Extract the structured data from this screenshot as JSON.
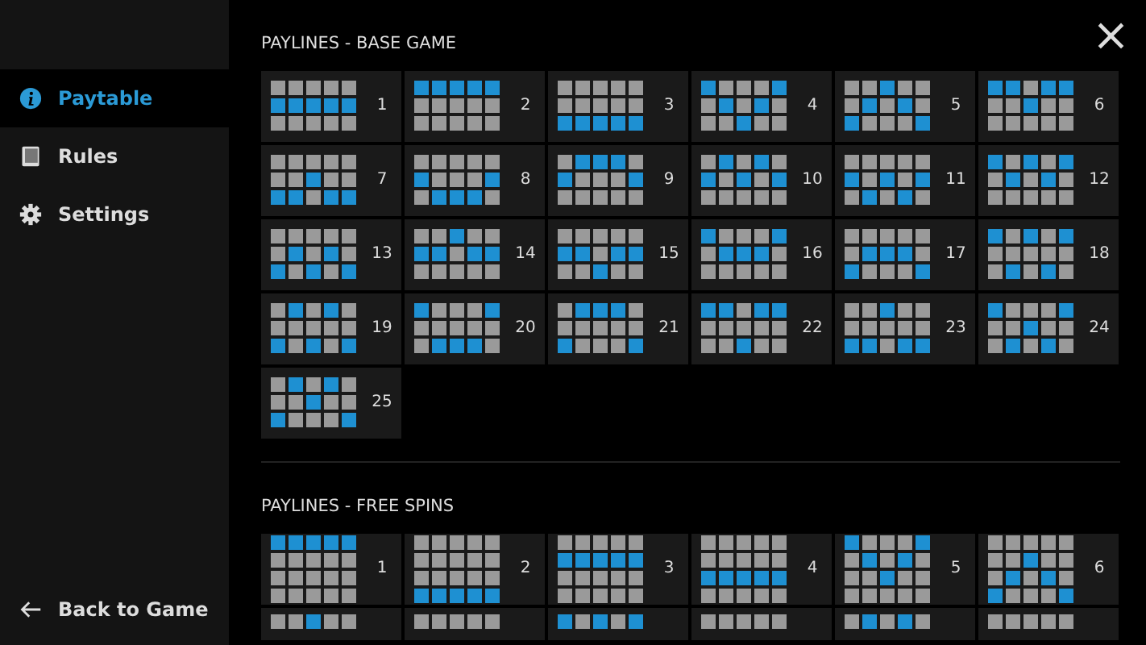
{
  "sidebar": {
    "items": [
      {
        "label": "Paytable",
        "selected": true
      },
      {
        "label": "Rules",
        "selected": false
      },
      {
        "label": "Settings",
        "selected": false
      }
    ],
    "back": {
      "label": "Back to Game"
    }
  },
  "close": {
    "label": "×"
  },
  "sections": [
    {
      "title": "PAYLINES - BASE GAME",
      "lines": [
        {
          "number": "1",
          "cells": [
            [
              false,
              false,
              false,
              false,
              false
            ],
            [
              true,
              true,
              true,
              true,
              true
            ],
            [
              false,
              false,
              false,
              false,
              false
            ]
          ]
        },
        {
          "number": "2",
          "cells": [
            [
              true,
              true,
              true,
              true,
              true
            ],
            [
              false,
              false,
              false,
              false,
              false
            ],
            [
              false,
              false,
              false,
              false,
              false
            ]
          ]
        },
        {
          "number": "3",
          "cells": [
            [
              false,
              false,
              false,
              false,
              false
            ],
            [
              false,
              false,
              false,
              false,
              false
            ],
            [
              true,
              true,
              true,
              true,
              true
            ]
          ]
        },
        {
          "number": "4",
          "cells": [
            [
              true,
              false,
              false,
              false,
              true
            ],
            [
              false,
              true,
              false,
              true,
              false
            ],
            [
              false,
              false,
              true,
              false,
              false
            ]
          ]
        },
        {
          "number": "5",
          "cells": [
            [
              false,
              false,
              true,
              false,
              false
            ],
            [
              false,
              true,
              false,
              true,
              false
            ],
            [
              true,
              false,
              false,
              false,
              true
            ]
          ]
        },
        {
          "number": "6",
          "cells": [
            [
              true,
              true,
              false,
              true,
              true
            ],
            [
              false,
              false,
              true,
              false,
              false
            ],
            [
              false,
              false,
              false,
              false,
              false
            ]
          ]
        },
        {
          "number": "7",
          "cells": [
            [
              false,
              false,
              false,
              false,
              false
            ],
            [
              false,
              false,
              true,
              false,
              false
            ],
            [
              true,
              true,
              false,
              true,
              true
            ]
          ]
        },
        {
          "number": "8",
          "cells": [
            [
              false,
              false,
              false,
              false,
              false
            ],
            [
              true,
              false,
              false,
              false,
              true
            ],
            [
              false,
              true,
              true,
              true,
              false
            ]
          ]
        },
        {
          "number": "9",
          "cells": [
            [
              false,
              true,
              true,
              true,
              false
            ],
            [
              true,
              false,
              false,
              false,
              true
            ],
            [
              false,
              false,
              false,
              false,
              false
            ]
          ]
        },
        {
          "number": "10",
          "cells": [
            [
              false,
              true,
              false,
              true,
              false
            ],
            [
              true,
              false,
              true,
              false,
              true
            ],
            [
              false,
              false,
              false,
              false,
              false
            ]
          ]
        },
        {
          "number": "11",
          "cells": [
            [
              false,
              false,
              false,
              false,
              false
            ],
            [
              true,
              false,
              true,
              false,
              true
            ],
            [
              false,
              true,
              false,
              true,
              false
            ]
          ]
        },
        {
          "number": "12",
          "cells": [
            [
              true,
              false,
              true,
              false,
              true
            ],
            [
              false,
              true,
              false,
              true,
              false
            ],
            [
              false,
              false,
              false,
              false,
              false
            ]
          ]
        },
        {
          "number": "13",
          "cells": [
            [
              false,
              false,
              false,
              false,
              false
            ],
            [
              false,
              true,
              false,
              true,
              false
            ],
            [
              true,
              false,
              true,
              false,
              true
            ]
          ]
        },
        {
          "number": "14",
          "cells": [
            [
              false,
              false,
              true,
              false,
              false
            ],
            [
              true,
              true,
              false,
              true,
              true
            ],
            [
              false,
              false,
              false,
              false,
              false
            ]
          ]
        },
        {
          "number": "15",
          "cells": [
            [
              false,
              false,
              false,
              false,
              false
            ],
            [
              true,
              true,
              false,
              true,
              true
            ],
            [
              false,
              false,
              true,
              false,
              false
            ]
          ]
        },
        {
          "number": "16",
          "cells": [
            [
              true,
              false,
              false,
              false,
              true
            ],
            [
              false,
              true,
              true,
              true,
              false
            ],
            [
              false,
              false,
              false,
              false,
              false
            ]
          ]
        },
        {
          "number": "17",
          "cells": [
            [
              false,
              false,
              false,
              false,
              false
            ],
            [
              false,
              true,
              true,
              true,
              false
            ],
            [
              true,
              false,
              false,
              false,
              true
            ]
          ]
        },
        {
          "number": "18",
          "cells": [
            [
              true,
              false,
              true,
              false,
              true
            ],
            [
              false,
              false,
              false,
              false,
              false
            ],
            [
              false,
              true,
              false,
              true,
              false
            ]
          ]
        },
        {
          "number": "19",
          "cells": [
            [
              false,
              true,
              false,
              true,
              false
            ],
            [
              false,
              false,
              false,
              false,
              false
            ],
            [
              true,
              false,
              true,
              false,
              true
            ]
          ]
        },
        {
          "number": "20",
          "cells": [
            [
              true,
              false,
              false,
              false,
              true
            ],
            [
              false,
              false,
              false,
              false,
              false
            ],
            [
              false,
              true,
              true,
              true,
              false
            ]
          ]
        },
        {
          "number": "21",
          "cells": [
            [
              false,
              true,
              true,
              true,
              false
            ],
            [
              false,
              false,
              false,
              false,
              false
            ],
            [
              true,
              false,
              false,
              false,
              true
            ]
          ]
        },
        {
          "number": "22",
          "cells": [
            [
              true,
              true,
              false,
              true,
              true
            ],
            [
              false,
              false,
              false,
              false,
              false
            ],
            [
              false,
              false,
              true,
              false,
              false
            ]
          ]
        },
        {
          "number": "23",
          "cells": [
            [
              false,
              false,
              true,
              false,
              false
            ],
            [
              false,
              false,
              false,
              false,
              false
            ],
            [
              true,
              true,
              false,
              true,
              true
            ]
          ]
        },
        {
          "number": "24",
          "cells": [
            [
              true,
              false,
              false,
              false,
              true
            ],
            [
              false,
              false,
              true,
              false,
              false
            ],
            [
              false,
              true,
              false,
              true,
              false
            ]
          ]
        },
        {
          "number": "25",
          "cells": [
            [
              false,
              true,
              false,
              true,
              false
            ],
            [
              false,
              false,
              true,
              false,
              false
            ],
            [
              true,
              false,
              false,
              false,
              true
            ]
          ]
        }
      ]
    },
    {
      "title": "PAYLINES - FREE SPINS",
      "lines": [
        {
          "number": "1",
          "cells": [
            [
              true,
              true,
              true,
              true,
              true
            ],
            [
              false,
              false,
              false,
              false,
              false
            ],
            [
              false,
              false,
              false,
              false,
              false
            ],
            [
              false,
              false,
              false,
              false,
              false
            ]
          ]
        },
        {
          "number": "2",
          "cells": [
            [
              false,
              false,
              false,
              false,
              false
            ],
            [
              false,
              false,
              false,
              false,
              false
            ],
            [
              false,
              false,
              false,
              false,
              false
            ],
            [
              true,
              true,
              true,
              true,
              true
            ]
          ]
        },
        {
          "number": "3",
          "cells": [
            [
              false,
              false,
              false,
              false,
              false
            ],
            [
              true,
              true,
              true,
              true,
              true
            ],
            [
              false,
              false,
              false,
              false,
              false
            ],
            [
              false,
              false,
              false,
              false,
              false
            ]
          ]
        },
        {
          "number": "4",
          "cells": [
            [
              false,
              false,
              false,
              false,
              false
            ],
            [
              false,
              false,
              false,
              false,
              false
            ],
            [
              true,
              true,
              true,
              true,
              true
            ],
            [
              false,
              false,
              false,
              false,
              false
            ]
          ]
        },
        {
          "number": "5",
          "cells": [
            [
              true,
              false,
              false,
              false,
              true
            ],
            [
              false,
              true,
              false,
              true,
              false
            ],
            [
              false,
              false,
              true,
              false,
              false
            ],
            [
              false,
              false,
              false,
              false,
              false
            ]
          ]
        },
        {
          "number": "6",
          "cells": [
            [
              false,
              false,
              false,
              false,
              false
            ],
            [
              false,
              false,
              true,
              false,
              false
            ],
            [
              false,
              true,
              false,
              true,
              false
            ],
            [
              true,
              false,
              false,
              false,
              true
            ]
          ]
        },
        {
          "kind": "cut",
          "cells": [
            [
              false,
              false,
              true,
              false,
              false
            ]
          ]
        },
        {
          "kind": "cut",
          "cells": [
            [
              false,
              false,
              false,
              false,
              false
            ]
          ]
        },
        {
          "kind": "cut",
          "cells": [
            [
              true,
              false,
              true,
              false,
              true
            ]
          ]
        },
        {
          "kind": "cut",
          "cells": [
            [
              false,
              false,
              false,
              false,
              false
            ]
          ]
        },
        {
          "kind": "cut",
          "cells": [
            [
              false,
              true,
              false,
              true,
              false
            ]
          ]
        },
        {
          "kind": "cut",
          "cells": [
            [
              false,
              false,
              false,
              false,
              false
            ]
          ]
        }
      ]
    }
  ]
}
